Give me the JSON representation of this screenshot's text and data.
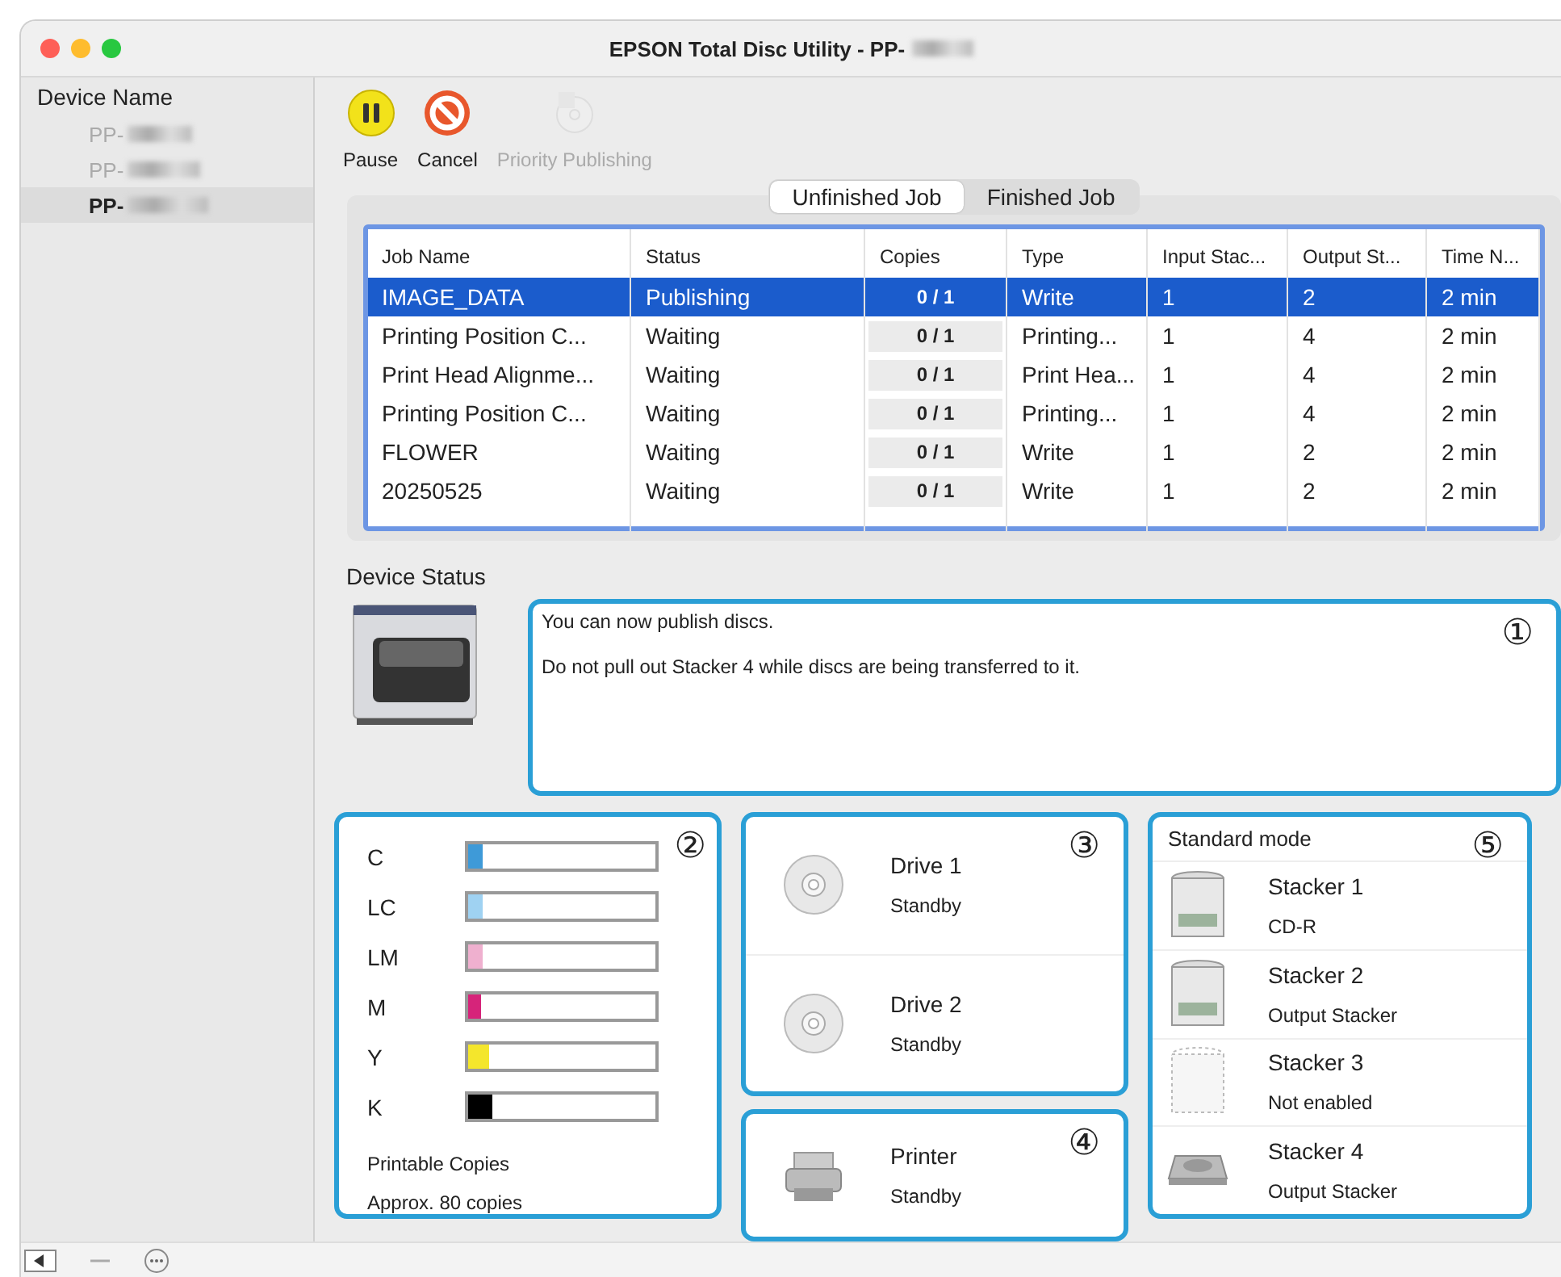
{
  "window": {
    "title": "EPSON Total Disc Utility - PP-"
  },
  "sidebar": {
    "title": "Device Name",
    "items": [
      {
        "label": "PP-",
        "selected": false
      },
      {
        "label": "PP-",
        "selected": false
      },
      {
        "label": "PP-",
        "selected": true
      }
    ]
  },
  "toolbar": [
    {
      "kind": "pause",
      "label": "Pause",
      "disabled": false
    },
    {
      "kind": "cancel",
      "label": "Cancel",
      "disabled": false
    },
    {
      "kind": "priority",
      "label": "Priority Publishing",
      "disabled": true
    }
  ],
  "tabs": [
    {
      "label": "Unfinished Job",
      "selected": true
    },
    {
      "label": "Finished Job",
      "selected": false
    }
  ],
  "table": {
    "columns": [
      "Job Name",
      "Status",
      "Copies",
      "Type",
      "Input Stac...",
      "Output St...",
      "Time N..."
    ],
    "rows": [
      {
        "selected": true,
        "cells": [
          "IMAGE_DATA",
          "Publishing",
          "0 / 1",
          "Write",
          "1",
          "2",
          "2 min"
        ]
      },
      {
        "selected": false,
        "cells": [
          "Printing Position C...",
          "Waiting",
          "0 / 1",
          "Printing...",
          "1",
          "4",
          "2 min"
        ]
      },
      {
        "selected": false,
        "cells": [
          "Print Head Alignme...",
          "Waiting",
          "0 / 1",
          "Print Hea...",
          "1",
          "4",
          "2 min"
        ]
      },
      {
        "selected": false,
        "cells": [
          "Printing Position C...",
          "Waiting",
          "0 / 1",
          "Printing...",
          "1",
          "4",
          "2 min"
        ]
      },
      {
        "selected": false,
        "cells": [
          "FLOWER",
          "Waiting",
          "0 / 1",
          "Write",
          "1",
          "2",
          "2 min"
        ]
      },
      {
        "selected": false,
        "cells": [
          "20250525",
          "Waiting",
          "0 / 1",
          "Write",
          "1",
          "2",
          "2 min"
        ]
      }
    ]
  },
  "device_status": {
    "title": "Device Status",
    "messages": [
      "You can now publish discs.",
      "Do not pull out Stacker 4 while discs are being transferred to it."
    ],
    "callout": "①"
  },
  "ink": {
    "callout": "②",
    "inks": [
      {
        "label": "C",
        "color": "#3e9ad8",
        "level": 0.08
      },
      {
        "label": "LC",
        "color": "#9fd2f2",
        "level": 0.08
      },
      {
        "label": "LM",
        "color": "#efb0cf",
        "level": 0.08
      },
      {
        "label": "M",
        "color": "#d6247a",
        "level": 0.07
      },
      {
        "label": "Y",
        "color": "#f4e62c",
        "level": 0.12
      },
      {
        "label": "K",
        "color": "#000000",
        "level": 0.13
      }
    ],
    "caption": "Printable Copies",
    "copies": "Approx. 80 copies"
  },
  "drives": {
    "callout": "③",
    "items": [
      {
        "name": "Drive 1",
        "status": "Standby"
      },
      {
        "name": "Drive 2",
        "status": "Standby"
      }
    ]
  },
  "printer": {
    "callout": "④",
    "name": "Printer",
    "status": "Standby"
  },
  "stackers": {
    "callout": "⑤",
    "mode": "Standard mode",
    "items": [
      {
        "kind": "stacker",
        "name": "Stacker 1",
        "status": "CD-R"
      },
      {
        "kind": "stacker",
        "name": "Stacker 2",
        "status": "Output Stacker"
      },
      {
        "kind": "disabled",
        "name": "Stacker 3",
        "status": "Not enabled"
      },
      {
        "kind": "tray",
        "name": "Stacker 4",
        "status": "Output Stacker"
      }
    ]
  }
}
